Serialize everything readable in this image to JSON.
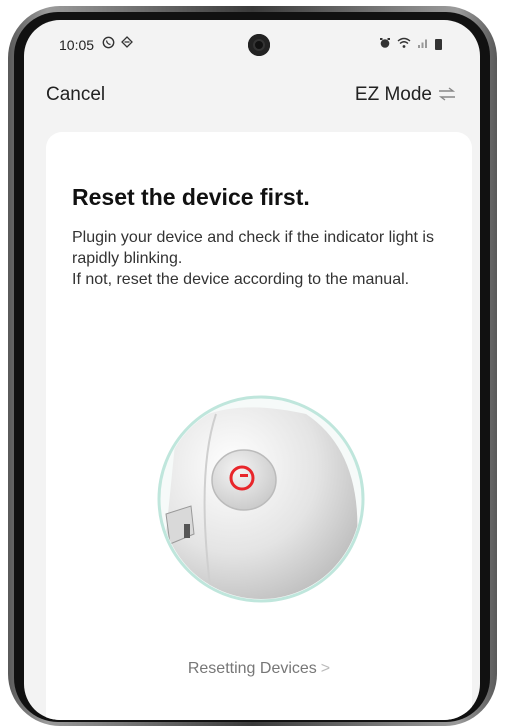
{
  "status_bar": {
    "time": "10:05",
    "left_icons": [
      "whatsapp-icon",
      "vpn-icon"
    ],
    "right_icons": [
      "alarm-icon",
      "wifi-icon",
      "signal-icon",
      "battery-icon"
    ]
  },
  "nav": {
    "cancel_label": "Cancel",
    "mode_label": "EZ Mode",
    "mode_icon": "swap-icon"
  },
  "card": {
    "title": "Reset the device first.",
    "description": "Plugin your device and check if the indicator light is rapidly blinking.\nIf not, reset the device according to the manual.",
    "illustration": "device-reset-button-illustration",
    "accent_color": "#e8262b",
    "illustration_ring_color": "#bfe6dc"
  },
  "footer_link": {
    "label": "Resetting Devices",
    "icon": "chevron-right-icon"
  }
}
